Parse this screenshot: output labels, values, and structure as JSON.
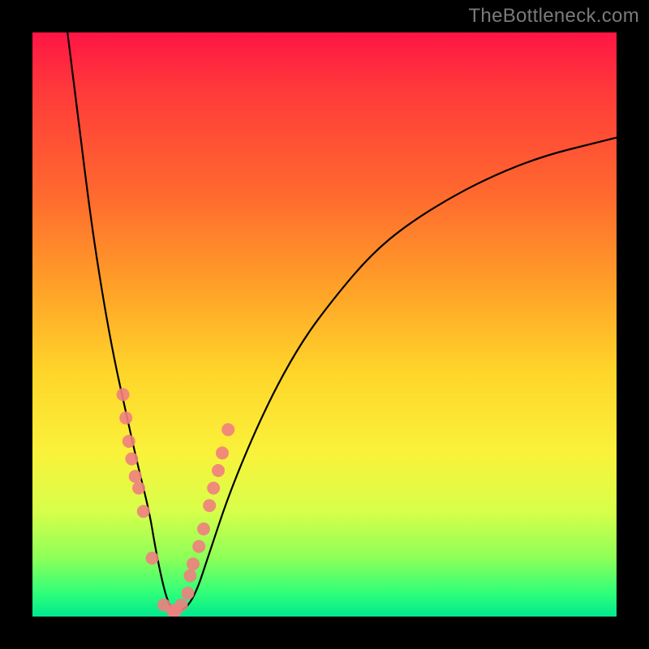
{
  "watermark": "TheBottleneck.com",
  "chart_data": {
    "type": "line",
    "title": "",
    "xlabel": "",
    "ylabel": "",
    "xlim": [
      0,
      100
    ],
    "ylim": [
      0,
      100
    ],
    "grid": false,
    "legend": false,
    "background_gradient": {
      "top": "#ff1545",
      "middle": "#ffd52a",
      "bottom": "#00e98e"
    },
    "series": [
      {
        "name": "v-curve",
        "x": [
          6,
          8,
          10,
          12,
          14,
          16,
          18,
          20,
          21,
          22,
          23,
          24,
          26,
          28,
          30,
          34,
          40,
          46,
          52,
          58,
          64,
          72,
          80,
          88,
          96,
          100
        ],
        "values": [
          100,
          84,
          68,
          55,
          44,
          35,
          26,
          18,
          12,
          7,
          3,
          1,
          1,
          4,
          10,
          22,
          36,
          47,
          55,
          62,
          67,
          72,
          76,
          79,
          81,
          82
        ]
      }
    ],
    "scatter_overlay": {
      "name": "pink-dots",
      "color": "#f08080",
      "x": [
        15.5,
        16.0,
        16.5,
        17.0,
        17.6,
        18.2,
        19.0,
        20.5,
        22.5,
        24.0,
        24.5,
        25.5,
        26.6,
        27.0,
        27.5,
        28.5,
        29.3,
        30.3,
        31.0,
        31.8,
        32.5,
        33.5
      ],
      "y": [
        38,
        34,
        30,
        27,
        24,
        22,
        18,
        10,
        2,
        1,
        1,
        2,
        4,
        7,
        9,
        12,
        15,
        19,
        22,
        25,
        28,
        32
      ]
    }
  }
}
